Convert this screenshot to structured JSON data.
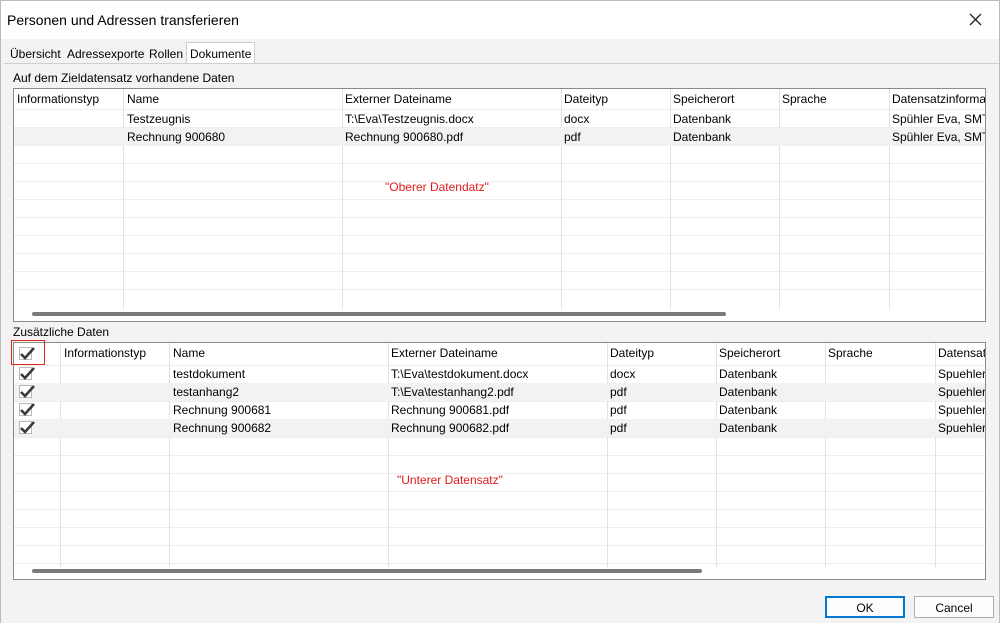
{
  "window": {
    "title": "Personen und Adressen transferieren"
  },
  "tabs": [
    {
      "label": "Übersicht",
      "active": false
    },
    {
      "label": "Adressexporte",
      "active": false
    },
    {
      "label": "Rollen",
      "active": false
    },
    {
      "label": "Dokumente",
      "active": true
    }
  ],
  "upper": {
    "label": "Auf dem Zieldatensatz vorhandene Daten",
    "columns": [
      "Informationstyp",
      "Name",
      "Externer Dateiname",
      "Dateityp",
      "Speicherort",
      "Sprache",
      "Datensatzinformat"
    ],
    "rows": [
      [
        "",
        "Testzeugnis",
        "T:\\Eva\\Testzeugnis.docx",
        "docx",
        "Datenbank",
        "",
        "Spühler Eva, SMT S"
      ],
      [
        "",
        "Rechnung 900680",
        "Rechnung 900680.pdf",
        "pdf",
        "Datenbank",
        "",
        "Spühler Eva, SMT S"
      ]
    ],
    "annotation": "\"Oberer Datendatz\""
  },
  "lower": {
    "label": "Zusätzliche Daten",
    "columns": [
      "Informationstyp",
      "Name",
      "Externer Dateiname",
      "Dateityp",
      "Speicherort",
      "Sprache",
      "Datensatz"
    ],
    "rows": [
      {
        "checked": true,
        "cells": [
          "",
          "testdokument",
          "T:\\Eva\\testdokument.docx",
          "docx",
          "Datenbank",
          "",
          "Spuehler"
        ]
      },
      {
        "checked": true,
        "cells": [
          "",
          "testanhang2",
          "T:\\Eva\\testanhang2.pdf",
          "pdf",
          "Datenbank",
          "",
          "Spuehler"
        ]
      },
      {
        "checked": true,
        "cells": [
          "",
          "Rechnung 900681",
          "Rechnung 900681.pdf",
          "pdf",
          "Datenbank",
          "",
          "Spuehler"
        ]
      },
      {
        "checked": true,
        "cells": [
          "",
          "Rechnung 900682",
          "Rechnung 900682.pdf",
          "pdf",
          "Datenbank",
          "",
          "Spuehler"
        ]
      }
    ],
    "annotation": "\"Unterer Datensatz\""
  },
  "buttons": {
    "ok": "OK",
    "cancel": "Cancel"
  },
  "colors": {
    "annotation": "#e01b1b",
    "default_button_border": "#0078d4",
    "highlight_box": "#e0261b"
  }
}
